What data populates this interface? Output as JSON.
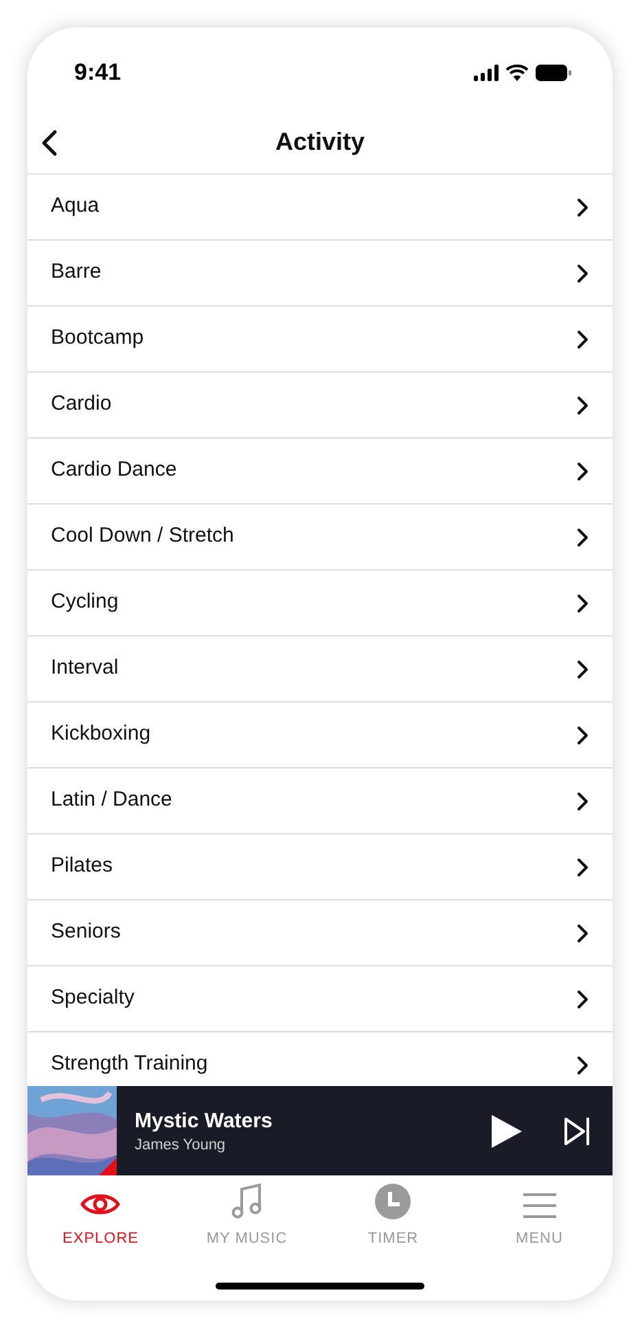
{
  "status_bar": {
    "time": "9:41"
  },
  "header": {
    "title": "Activity"
  },
  "activities": [
    "Aqua",
    "Barre",
    "Bootcamp",
    "Cardio",
    "Cardio Dance",
    "Cool Down / Stretch",
    "Cycling",
    "Interval",
    "Kickboxing",
    "Latin / Dance",
    "Pilates",
    "Seniors",
    "Specialty",
    "Strength Training"
  ],
  "now_playing": {
    "title": "Mystic Waters",
    "artist": "James Young"
  },
  "tab_bar": [
    {
      "label": "EXPLORE",
      "selected": true
    },
    {
      "label": "MY MUSIC",
      "selected": false
    },
    {
      "label": "TIMER",
      "selected": false
    },
    {
      "label": "MENU",
      "selected": false
    }
  ]
}
